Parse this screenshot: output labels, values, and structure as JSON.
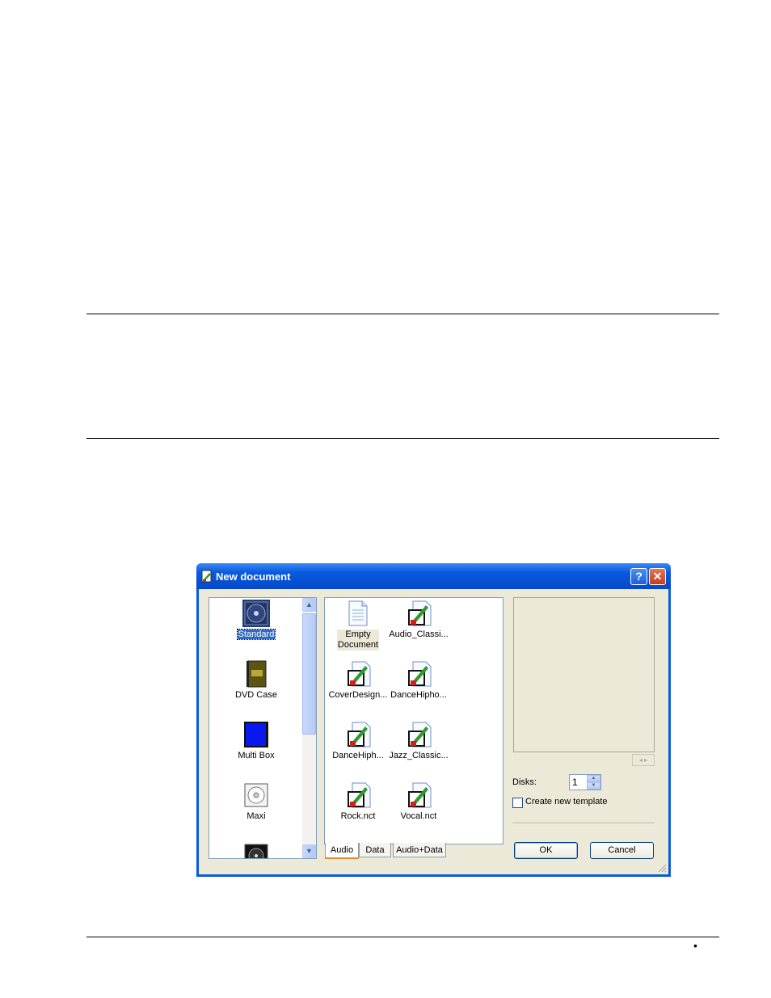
{
  "dialog": {
    "title": "New document",
    "help_label": "?",
    "close_label": "✕"
  },
  "left_list": {
    "items": [
      {
        "label": "Standard",
        "icon": "standard-cd-icon",
        "selected": true
      },
      {
        "label": "DVD Case",
        "icon": "dvd-case-icon"
      },
      {
        "label": "Multi Box",
        "icon": "multi-box-icon"
      },
      {
        "label": "Maxi",
        "icon": "maxi-icon"
      }
    ],
    "scroll_up": "▲",
    "scroll_down": "▼"
  },
  "templates": {
    "items": [
      {
        "label": "Empty Document",
        "icon": "empty-document-icon",
        "selected": true
      },
      {
        "label": "Audio_Classi...",
        "icon": "template-file-icon"
      },
      {
        "label": "CoverDesign...",
        "icon": "template-file-icon"
      },
      {
        "label": "DanceHipho...",
        "icon": "template-file-icon"
      },
      {
        "label": "DanceHiph...",
        "icon": "template-file-icon"
      },
      {
        "label": "Jazz_Classic...",
        "icon": "template-file-icon"
      },
      {
        "label": "Rock.nct",
        "icon": "template-file-icon"
      },
      {
        "label": "Vocal.nct",
        "icon": "template-file-icon"
      }
    ]
  },
  "tabs": [
    {
      "label": "Audio",
      "active": true
    },
    {
      "label": "Data"
    },
    {
      "label": "Audio+Data"
    }
  ],
  "options": {
    "disks_label": "Disks:",
    "disks_value": "1",
    "create_template_label": "Create new template",
    "create_template_checked": false
  },
  "buttons": {
    "ok": "OK",
    "cancel": "Cancel"
  },
  "page": {
    "bullet": "•"
  },
  "colors": {
    "title_bar": "#0a5ae0",
    "selection": "#316ac5",
    "dialog_face": "#ece9d8"
  }
}
